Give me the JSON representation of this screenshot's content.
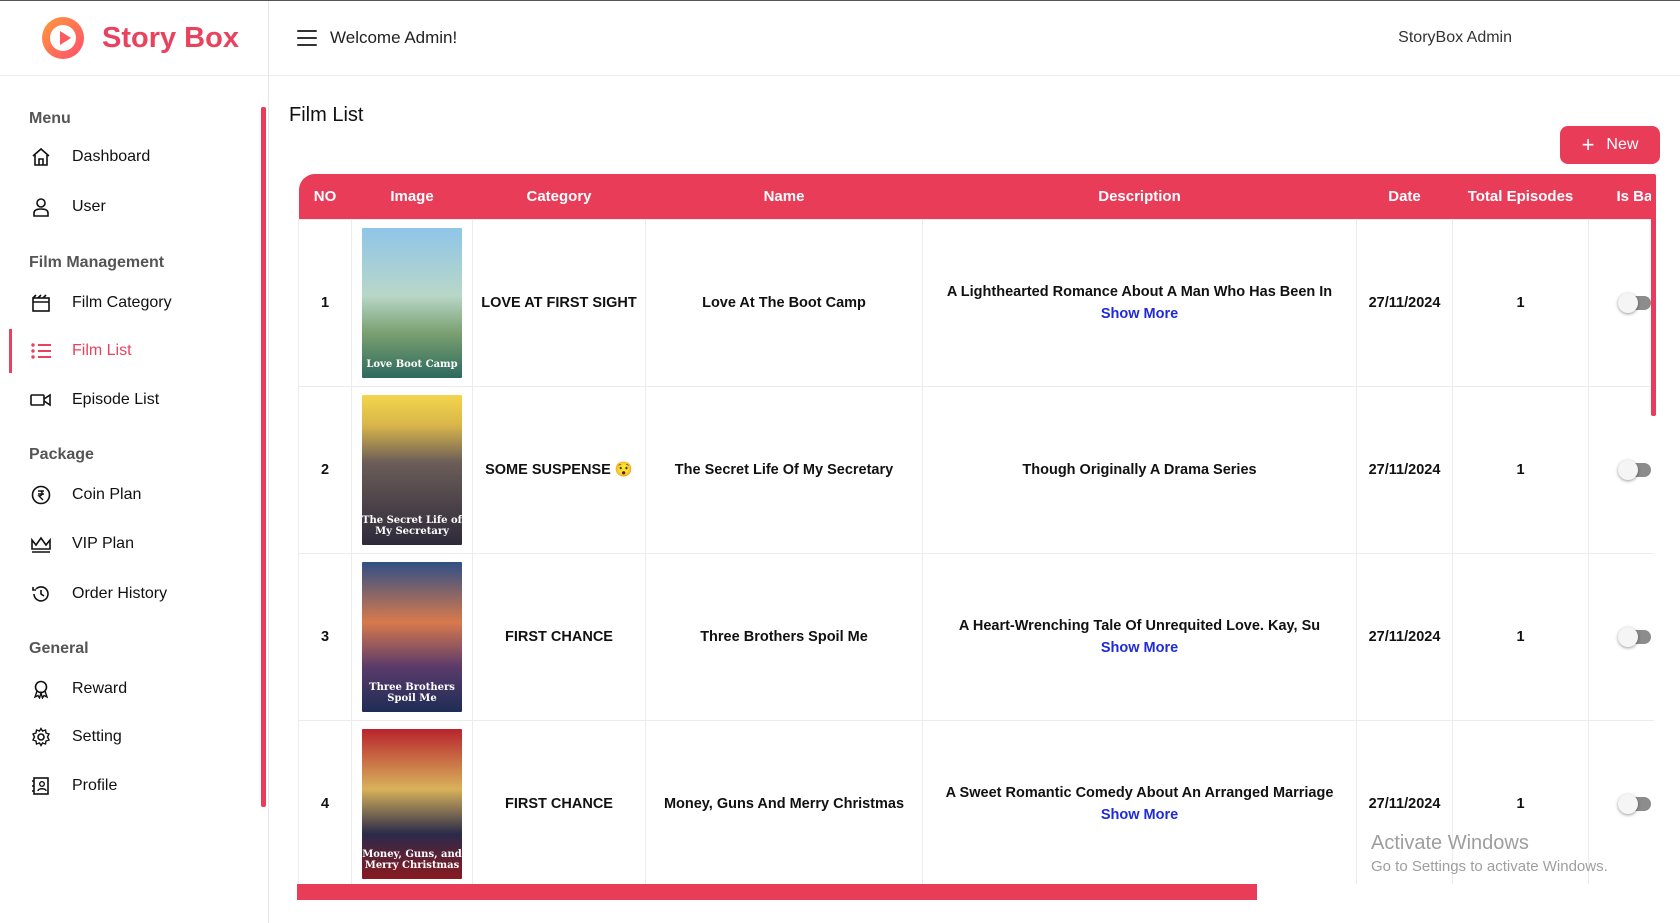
{
  "brand": {
    "name": "Story Box"
  },
  "header": {
    "welcome": "Welcome Admin!",
    "user": "StoryBox Admin"
  },
  "sidebar": {
    "sections": [
      "Menu",
      "Film Management",
      "Package",
      "General"
    ],
    "items": [
      {
        "label": "Dashboard",
        "icon": "home-icon"
      },
      {
        "label": "User",
        "icon": "user-icon"
      },
      {
        "label": "Film Category",
        "icon": "clapperboard-icon"
      },
      {
        "label": "Film List",
        "icon": "list-icon"
      },
      {
        "label": "Episode List",
        "icon": "video-icon"
      },
      {
        "label": "Coin Plan",
        "icon": "rupee-coin-icon"
      },
      {
        "label": "VIP Plan",
        "icon": "crown-icon"
      },
      {
        "label": "Order History",
        "icon": "history-icon"
      },
      {
        "label": "Reward",
        "icon": "award-icon"
      },
      {
        "label": "Setting",
        "icon": "gear-icon"
      },
      {
        "label": "Profile",
        "icon": "profile-card-icon"
      }
    ],
    "active": "Film List"
  },
  "page": {
    "title": "Film List",
    "new_button": "New"
  },
  "table": {
    "columns": [
      "NO",
      "Image",
      "Category",
      "Name",
      "Description",
      "Date",
      "Total Episodes",
      "Is Banner"
    ],
    "rows": [
      {
        "no": "1",
        "poster_caption": "Love Boot Camp",
        "category": "LOVE AT FIRST SIGHT",
        "name": "Love At The Boot Camp",
        "description": "A Lighthearted Romance About A Man Who Has Been In",
        "show_more": "Show More",
        "date": "27/11/2024",
        "episodes": "1"
      },
      {
        "no": "2",
        "poster_caption": "The Secret Life of My Secretary",
        "category": "SOME SUSPENSE 😯",
        "name": "The Secret Life Of My Secretary",
        "description": "Though Originally A Drama Series",
        "show_more": "",
        "date": "27/11/2024",
        "episodes": "1"
      },
      {
        "no": "3",
        "poster_caption": "Three Brothers Spoil Me",
        "category": "FIRST CHANCE",
        "name": "Three Brothers Spoil Me",
        "description": "A Heart-Wrenching Tale Of Unrequited Love. Kay, Su",
        "show_more": "Show More",
        "date": "27/11/2024",
        "episodes": "1"
      },
      {
        "no": "4",
        "poster_caption": "Money, Guns, and Merry Christmas",
        "category": "FIRST CHANCE",
        "name": "Money, Guns And Merry Christmas",
        "description": "A Sweet Romantic Comedy About An Arranged Marriage",
        "show_more": "Show More",
        "date": "27/11/2024",
        "episodes": "1"
      }
    ]
  },
  "watermark": {
    "line1": "Activate Windows",
    "line2": "Go to Settings to activate Windows."
  },
  "colors": {
    "accent": "#e93c58",
    "link": "#1f2ad8"
  }
}
